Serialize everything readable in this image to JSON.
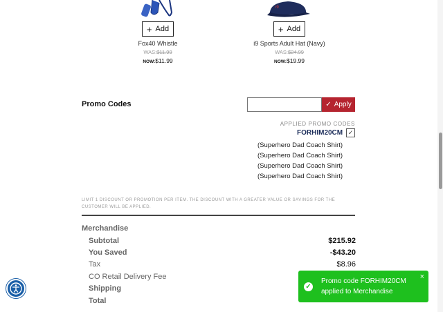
{
  "products": [
    {
      "name": "Fox40 Whistle",
      "add_label": "Add",
      "was_label": "WAS:",
      "was_price": "$11.99",
      "now_label": "NOW:",
      "now_price": "$11.99",
      "image_icon": "whistle-icon"
    },
    {
      "name": "i9 Sports Adult Hat (Navy)",
      "add_label": "Add",
      "was_label": "WAS:",
      "was_price": "$24.99",
      "now_label": "NOW:",
      "now_price": "$19.99",
      "image_icon": "hat-icon"
    }
  ],
  "promo": {
    "title": "Promo Codes",
    "input_value": "",
    "apply_label": "Apply",
    "applied_heading": "APPLIED PROMO CODES",
    "applied_code": "FORHIM20CM",
    "applied_items": [
      "(Superhero Dad Coach Shirt)",
      "(Superhero Dad Coach Shirt)",
      "(Superhero Dad Coach Shirt)",
      "(Superhero Dad Coach Shirt)"
    ],
    "disclaimer": "LIMIT 1 DISCOUNT OR PROMOTION PER ITEM. THE DISCOUNT WITH A GREATER VALUE OR SAVINGS FOR THE CUSTOMER WILL BE APPLIED."
  },
  "summary": {
    "section_title": "Merchandise",
    "subtotal_label": "Subtotal",
    "subtotal_value": "$215.92",
    "saved_label": "You Saved",
    "saved_value": "-$43.20",
    "tax_label": "Tax",
    "tax_value": "$8.96",
    "delivery_label": "CO Retail Delivery Fee",
    "shipping_label": "Shipping",
    "total_label": "Total"
  },
  "toast": {
    "message": "Promo code FORHIM20CM applied to Merchandise",
    "close_label": "×"
  },
  "colors": {
    "apply_button": "#b5242f",
    "toast_bg": "#1ec01e",
    "code_text": "#1c2d5a",
    "accessibility_button": "#1a5fa8"
  }
}
